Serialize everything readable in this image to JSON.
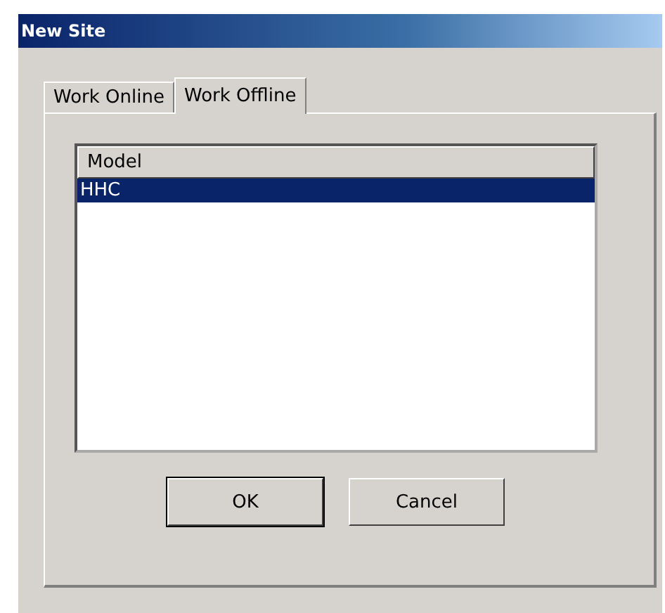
{
  "window": {
    "title": "New Site"
  },
  "tabs": [
    {
      "label": "Work Online",
      "selected": false
    },
    {
      "label": "Work Offline",
      "selected": true
    }
  ],
  "list": {
    "columns": [
      "Model"
    ],
    "rows": [
      {
        "cells": [
          "HHC"
        ],
        "selected": true
      }
    ]
  },
  "buttons": [
    {
      "label": "OK",
      "default": true
    },
    {
      "label": "Cancel",
      "default": false
    }
  ]
}
